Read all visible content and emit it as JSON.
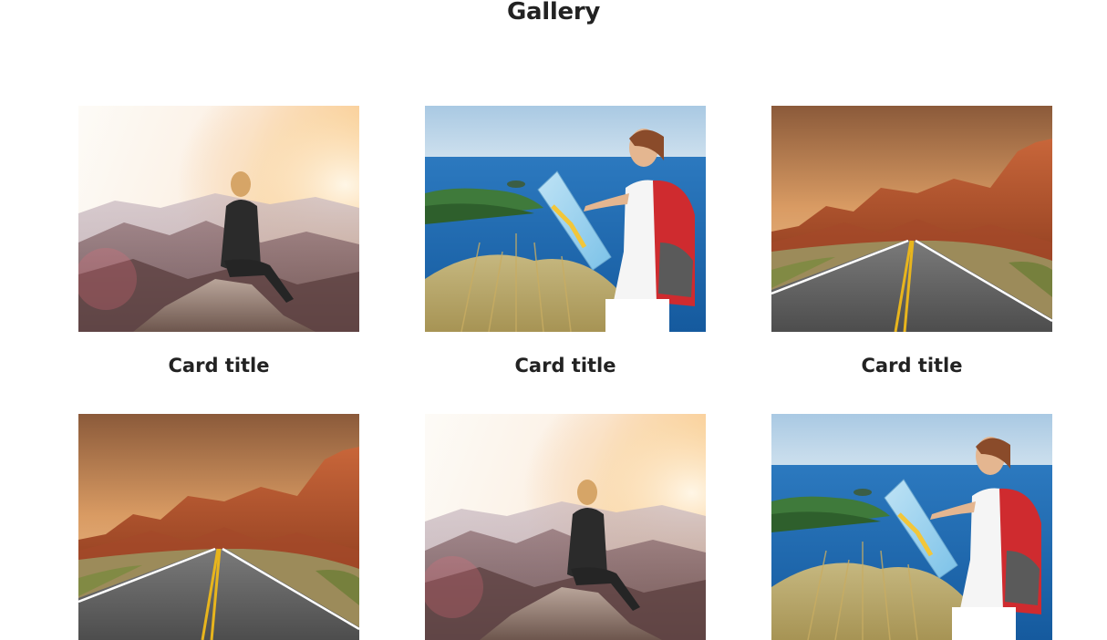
{
  "page": {
    "title": "Gallery"
  },
  "cards": [
    {
      "title": "Card title",
      "image": "woman-on-rock-sunset"
    },
    {
      "title": "Card title",
      "image": "hiker-with-map-sea"
    },
    {
      "title": "Card title",
      "image": "desert-road-canyon"
    },
    {
      "title": "",
      "image": "desert-road-canyon"
    },
    {
      "title": "",
      "image": "woman-on-rock-sunset"
    },
    {
      "title": "",
      "image": "hiker-with-map-sea"
    }
  ]
}
